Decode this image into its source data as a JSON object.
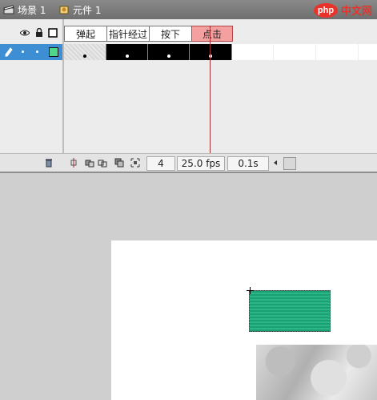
{
  "breadcrumb": {
    "scene_label": "场景 1",
    "symbol_label": "元件 1"
  },
  "brand": {
    "logo_text": "php",
    "site_name": "中文网"
  },
  "timeline": {
    "frame_labels": [
      "弹起",
      "指针经过",
      "按下",
      "点击"
    ],
    "active_frame_label": "点击",
    "status": {
      "current_frame": "4",
      "frame_rate": "25.0 fps",
      "elapsed_time": "0.1s"
    }
  },
  "colors": {
    "layer_selected": "#3e8ed4",
    "playhead": "#a03030",
    "shape_fill": "#1e9e74",
    "active_label": "#f5a0a0"
  },
  "icons": [
    "clapper-icon",
    "symbol-icon",
    "eye-icon",
    "lock-icon",
    "outline-icon",
    "pencil-icon",
    "trash-icon",
    "center-frame-icon",
    "onion-skin-icon",
    "onion-outline-icon",
    "edit-multiple-icon",
    "onion-markers-icon"
  ]
}
